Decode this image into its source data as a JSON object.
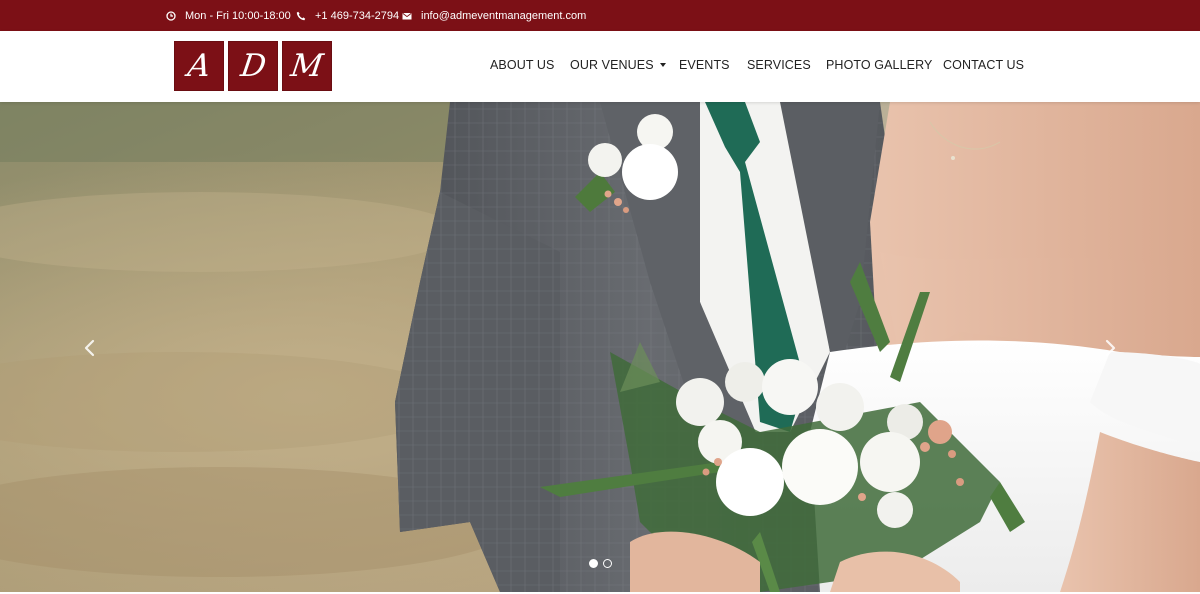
{
  "topbar": {
    "hours": "Mon - Fri 10:00-18:00",
    "phone": "+1 469-734-2794",
    "email": "info@admeventmanagement.com",
    "background": "#7c1016",
    "icons": [
      "clock-icon",
      "phone-icon",
      "envelope-icon"
    ]
  },
  "logo": {
    "letters": [
      "A",
      "D",
      "M"
    ],
    "color": "#7c1016"
  },
  "nav": {
    "items": [
      {
        "label": "ABOUT US"
      },
      {
        "label": "OUR VENUES",
        "has_dropdown": true
      },
      {
        "label": "EVENTS"
      },
      {
        "label": "SERVICES"
      },
      {
        "label": "PHOTO GALLERY"
      },
      {
        "label": "CONTACT US"
      }
    ]
  },
  "hero": {
    "slide_count": 2,
    "active_slide": 1,
    "icons": [
      "chevron-left-icon",
      "chevron-right-icon"
    ]
  }
}
